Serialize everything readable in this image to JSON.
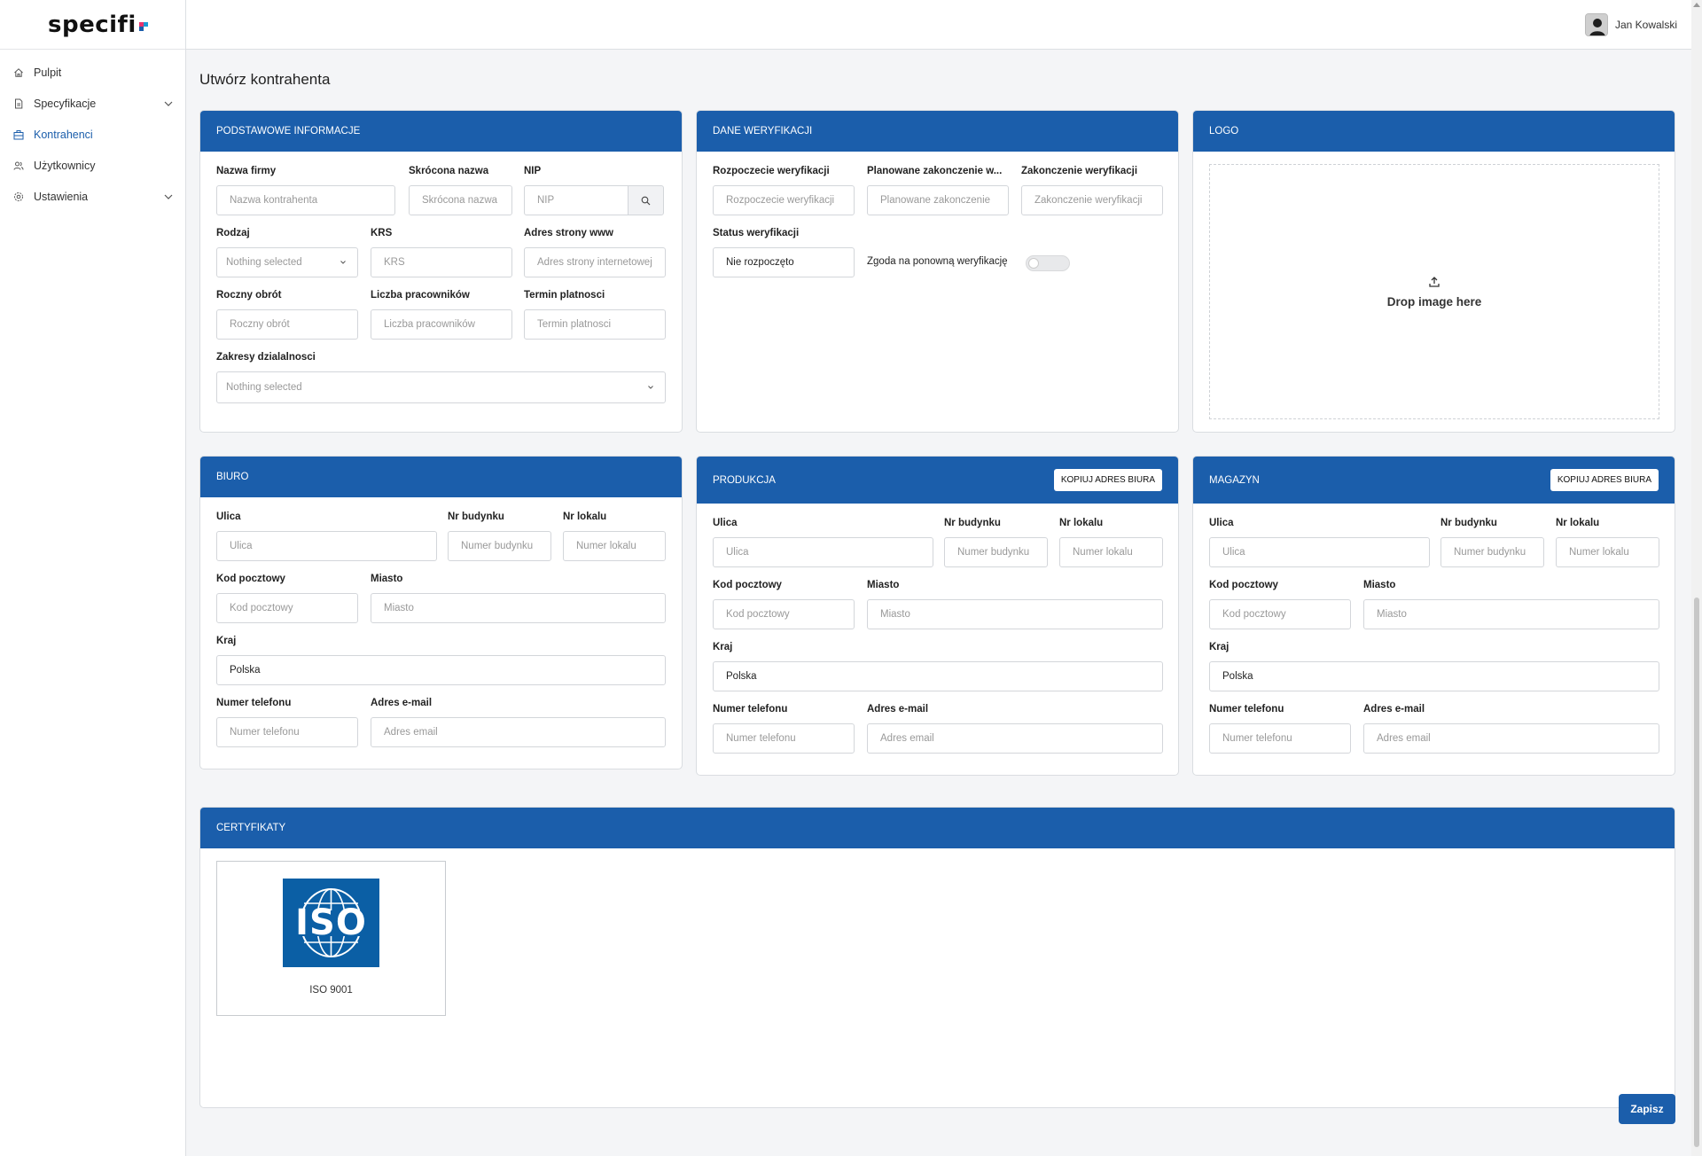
{
  "app": {
    "logo_text": "specifi",
    "logo_colors": [
      "#e8336d",
      "#1b9ad6",
      "#1b5eab"
    ],
    "accent": "#1b5eab"
  },
  "user": {
    "name": "Jan Kowalski"
  },
  "sidebar": {
    "items": [
      {
        "label": "Pulpit",
        "icon": "home-icon"
      },
      {
        "label": "Specyfikacje",
        "icon": "document-icon",
        "expandable": true
      },
      {
        "label": "Kontrahenci",
        "icon": "building-icon",
        "active": true
      },
      {
        "label": "Użytkownicy",
        "icon": "users-icon"
      },
      {
        "label": "Ustawienia",
        "icon": "gear-icon",
        "expandable": true
      }
    ]
  },
  "page": {
    "title": "Utwórz kontrahenta"
  },
  "basic": {
    "header": "PODSTAWOWE INFORMACJE",
    "company_name": {
      "label": "Nazwa firmy",
      "placeholder": "Nazwa kontrahenta"
    },
    "short_name": {
      "label": "Skrócona nazwa",
      "placeholder": "Skrócona nazwa"
    },
    "nip": {
      "label": "NIP",
      "placeholder": "NIP"
    },
    "type": {
      "label": "Rodzaj",
      "value": "Nothing selected"
    },
    "krs": {
      "label": "KRS",
      "placeholder": "KRS"
    },
    "website": {
      "label": "Adres strony www",
      "placeholder": "Adres strony internetowej"
    },
    "turnover": {
      "label": "Roczny obrót",
      "placeholder": "Roczny obrót"
    },
    "employees": {
      "label": "Liczba pracowników",
      "placeholder": "Liczba pracowników"
    },
    "payment_term": {
      "label": "Termin platnosci",
      "placeholder": "Termin platnosci"
    },
    "scopes": {
      "label": "Zakresy dzialalnosci",
      "value": "Nothing selected"
    }
  },
  "verification": {
    "header": "DANE WERYFIKACJI",
    "start": {
      "label": "Rozpoczecie weryfikacji",
      "placeholder": "Rozpoczecie weryfikacji"
    },
    "planned_end": {
      "label": "Planowane zakonczenie w...",
      "placeholder": "Planowane zakonczenie"
    },
    "end": {
      "label": "Zakonczenie weryfikacji",
      "placeholder": "Zakonczenie weryfikacji"
    },
    "status": {
      "label": "Status weryfikacji",
      "value": "Nie rozpoczęto"
    },
    "reverify": {
      "label": "Zgoda na ponowną weryfikację",
      "enabled": false
    }
  },
  "logo": {
    "header": "LOGO",
    "drop_text": "Drop image here"
  },
  "office": {
    "header": "BIURO",
    "street": {
      "label": "Ulica",
      "placeholder": "Ulica"
    },
    "building": {
      "label": "Nr budynku",
      "placeholder": "Numer budynku"
    },
    "unit": {
      "label": "Nr lokalu",
      "placeholder": "Numer lokalu"
    },
    "postal": {
      "label": "Kod pocztowy",
      "placeholder": "Kod pocztowy"
    },
    "city": {
      "label": "Miasto",
      "placeholder": "Miasto"
    },
    "country": {
      "label": "Kraj",
      "value": "Polska"
    },
    "phone": {
      "label": "Numer telefonu",
      "placeholder": "Numer telefonu"
    },
    "email": {
      "label": "Adres e-mail",
      "placeholder": "Adres email"
    }
  },
  "production": {
    "header": "PRODUKCJA",
    "copy_label": "KOPIUJ ADRES BIURA",
    "street": {
      "label": "Ulica",
      "placeholder": "Ulica"
    },
    "building": {
      "label": "Nr budynku",
      "placeholder": "Numer budynku"
    },
    "unit": {
      "label": "Nr lokalu",
      "placeholder": "Numer lokalu"
    },
    "postal": {
      "label": "Kod pocztowy",
      "placeholder": "Kod pocztowy"
    },
    "city": {
      "label": "Miasto",
      "placeholder": "Miasto"
    },
    "country": {
      "label": "Kraj",
      "value": "Polska"
    },
    "phone": {
      "label": "Numer telefonu",
      "placeholder": "Numer telefonu"
    },
    "email": {
      "label": "Adres e-mail",
      "placeholder": "Adres email"
    }
  },
  "warehouse": {
    "header": "MAGAZYN",
    "copy_label": "KOPIUJ ADRES BIURA",
    "street": {
      "label": "Ulica",
      "placeholder": "Ulica"
    },
    "building": {
      "label": "Nr budynku",
      "placeholder": "Numer budynku"
    },
    "unit": {
      "label": "Nr lokalu",
      "placeholder": "Numer lokalu"
    },
    "postal": {
      "label": "Kod pocztowy",
      "placeholder": "Kod pocztowy"
    },
    "city": {
      "label": "Miasto",
      "placeholder": "Miasto"
    },
    "country": {
      "label": "Kraj",
      "value": "Polska"
    },
    "phone": {
      "label": "Numer telefonu",
      "placeholder": "Numer telefonu"
    },
    "email": {
      "label": "Adres e-mail",
      "placeholder": "Adres email"
    }
  },
  "certificates": {
    "header": "CERTYFIKATY",
    "items": [
      {
        "name": "ISO 9001",
        "logo_text": "ISO"
      }
    ]
  },
  "actions": {
    "save_label": "Zapisz"
  }
}
